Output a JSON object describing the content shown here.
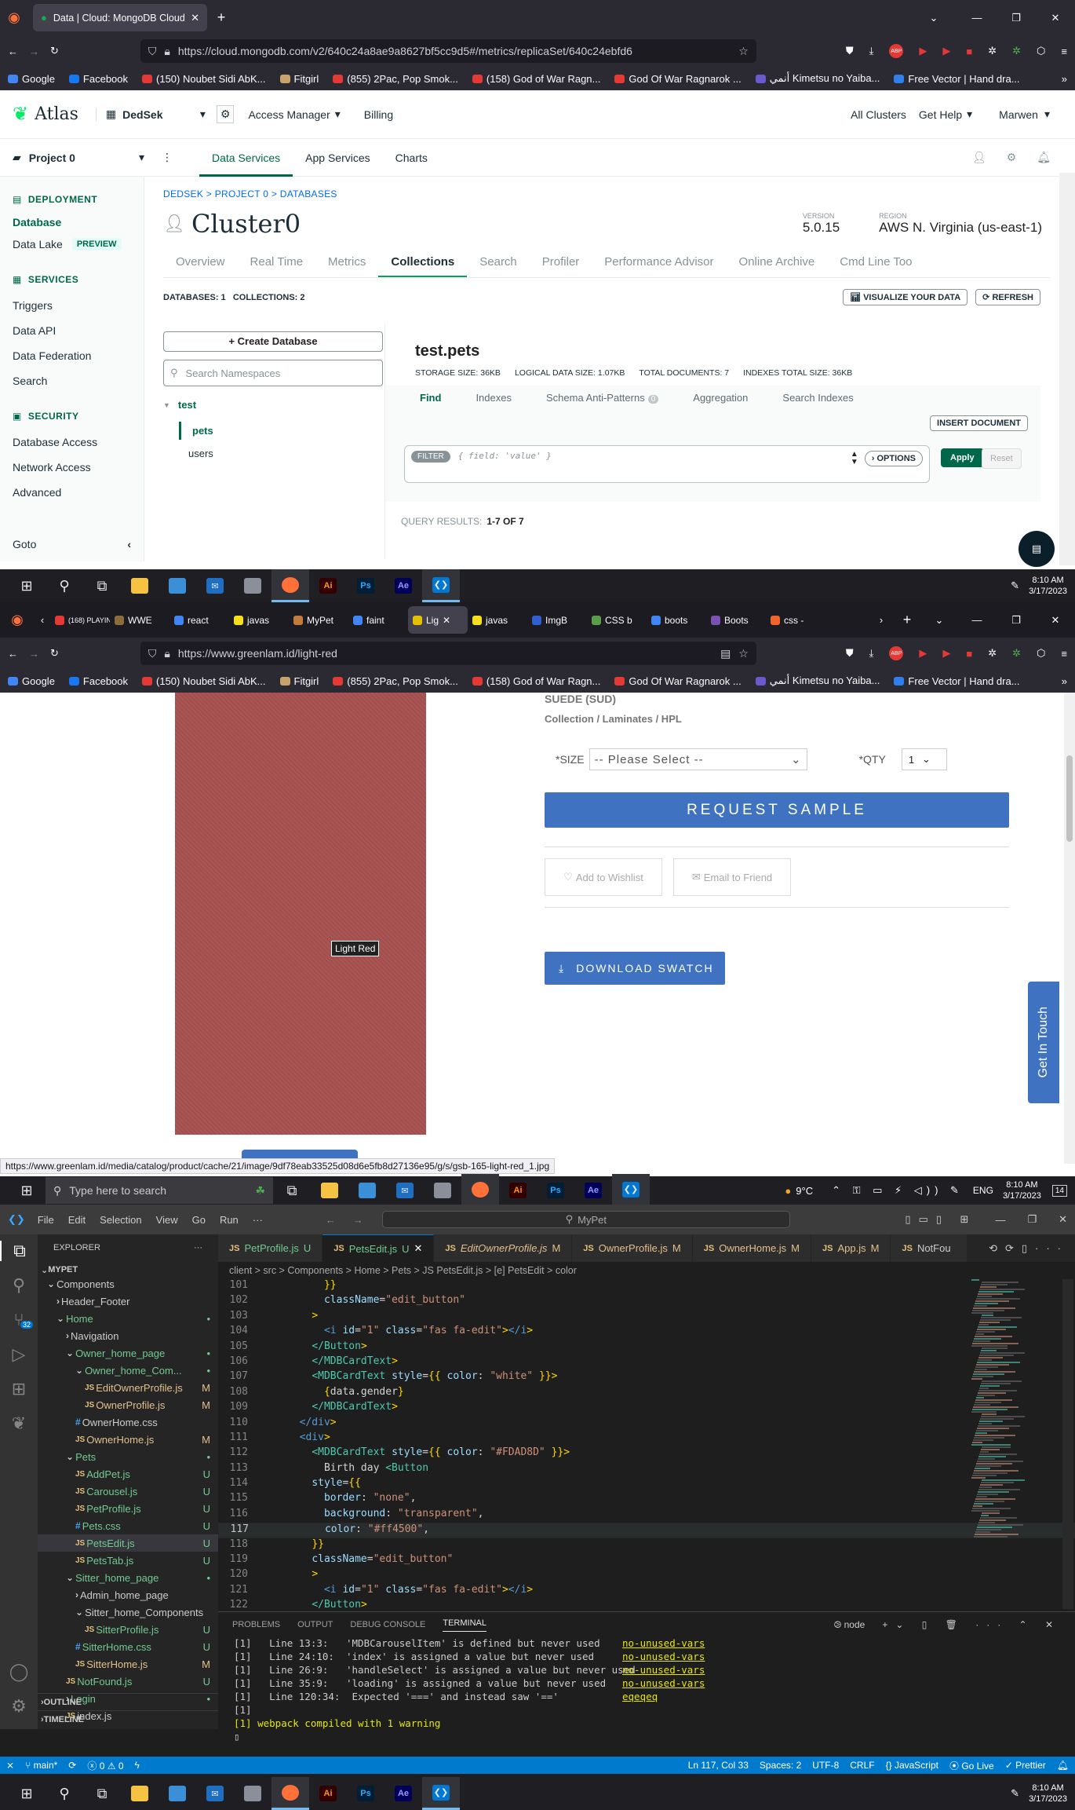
{
  "taskbar": {
    "time": "8:10 AM",
    "date": "3/17/2023",
    "search_placeholder": "Type here to search",
    "temp": "9°C",
    "lang": "ENG",
    "notif": "14"
  },
  "browser1": {
    "tab_title": "Data | Cloud: MongoDB Cloud",
    "url": "https://cloud.mongodb.com/v2/640c24a8ae9a8627bf5cc9d5#/metrics/replicaSet/640c24ebfd6",
    "bookmarks": [
      "Google",
      "Facebook",
      "(150) Noubet Sidi AbK...",
      "Fitgirl",
      "(855) 2Pac, Pop Smok...",
      "(158) God of War Ragn...",
      "God Of War Ragnarok ...",
      "أنمي Kimetsu no Yaiba...",
      "Free Vector | Hand dra..."
    ]
  },
  "atlas": {
    "logo": "Atlas",
    "org": "DedSek",
    "access_manager": "Access Manager",
    "billing": "Billing",
    "all_clusters": "All Clusters",
    "get_help": "Get Help",
    "user": "Marwen",
    "project": "Project 0",
    "nav": [
      "Data Services",
      "App Services",
      "Charts"
    ],
    "sidebar": {
      "deployment": "DEPLOYMENT",
      "database": "Database",
      "data_lake": "Data Lake",
      "preview": "PREVIEW",
      "services": "SERVICES",
      "triggers": "Triggers",
      "data_api": "Data API",
      "data_federation": "Data Federation",
      "search": "Search",
      "security": "SECURITY",
      "database_access": "Database Access",
      "network_access": "Network Access",
      "advanced": "Advanced",
      "goto": "Goto"
    },
    "breadcrumb": "DEDSEK > PROJECT 0 > DATABASES",
    "cluster": "Cluster0",
    "version_label": "VERSION",
    "version": "5.0.15",
    "region_label": "REGION",
    "region": "AWS N. Virginia (us-east-1)",
    "tabs": [
      "Overview",
      "Real Time",
      "Metrics",
      "Collections",
      "Search",
      "Profiler",
      "Performance Advisor",
      "Online Archive",
      "Cmd Line Too"
    ],
    "db_count": "DATABASES: 1   COLLECTIONS: 2",
    "visualize": "VISUALIZE YOUR DATA",
    "refresh": "REFRESH",
    "create_db": "+ Create Database",
    "search_ns": "Search Namespaces",
    "db_name": "test",
    "collections": [
      "pets",
      "users"
    ],
    "coll_title": "test.pets",
    "stats": [
      "STORAGE SIZE: 36KB",
      "LOGICAL DATA SIZE: 1.07KB",
      "TOTAL DOCUMENTS: 7",
      "INDEXES TOTAL SIZE: 36KB"
    ],
    "coll_tabs": [
      "Find",
      "Indexes",
      "Schema Anti-Patterns",
      "Aggregation",
      "Search Indexes"
    ],
    "schema_badge": "0",
    "insert_doc": "INSERT DOCUMENT",
    "filter_label": "FILTER",
    "filter_placeholder": "{ field: 'value' }",
    "options": "OPTIONS",
    "apply": "Apply",
    "reset": "Reset",
    "query_results_label": "QUERY RESULTS:",
    "query_results": "1-7 OF 7"
  },
  "browser2": {
    "tabs": [
      "(168) PLAYING",
      "WWE",
      "react",
      "javas",
      "MyPet",
      "faint",
      "Lig",
      "javas",
      "ImgB",
      "CSS b",
      "boots",
      "Boots",
      "css -"
    ],
    "url": "https://www.greenlam.id/light-red",
    "status_url": "https://www.greenlam.id/media/catalog/product/cache/21/image/9df78eab33525d08d6e5fb8d27136e95/g/s/gsb-165-light-red_1.jpg"
  },
  "greenlam": {
    "suede": "SUEDE (SUD)",
    "collection": "Collection / Laminates / HPL",
    "size_label": "*SIZE",
    "size_value": "-- Please Select --",
    "qty_label": "*QTY",
    "qty_value": "1",
    "request_sample": "REQUEST SAMPLE",
    "wishlist": "Add to Wishlist",
    "email_friend": "Email to Friend",
    "download": "DOWNLOAD SWATCH",
    "swatch_label": "Light Red",
    "get_in_touch": "Get In Touch",
    "swatch_color": "#a65150"
  },
  "vscode": {
    "menu": [
      "File",
      "Edit",
      "Selection",
      "View",
      "Go",
      "Run",
      "···"
    ],
    "search": "MyPet",
    "explorer": "EXPLORER",
    "root": "MYPET",
    "tabs": [
      {
        "name": "PetProfile.js",
        "badge": "U"
      },
      {
        "name": "PetsEdit.js",
        "badge": "U"
      },
      {
        "name": "EditOwnerProfile.js",
        "badge": "M"
      },
      {
        "name": "OwnerProfile.js",
        "badge": "M"
      },
      {
        "name": "OwnerHome.js",
        "badge": "M"
      },
      {
        "name": "App.js",
        "badge": "M"
      },
      {
        "name": "NotFou",
        "badge": ""
      }
    ],
    "breadcrumb": "client > src > Components > Home > Pets > JS PetsEdit.js > [e] PetsEdit > color",
    "tree": [
      {
        "t": "Components",
        "d": 1,
        "k": "f",
        "s": ""
      },
      {
        "t": "Header_Footer",
        "d": 2,
        "k": "fc",
        "s": ""
      },
      {
        "t": "Home",
        "d": 2,
        "k": "f",
        "s": "•"
      },
      {
        "t": "Navigation",
        "d": 3,
        "k": "fc",
        "s": ""
      },
      {
        "t": "Owner_home_page",
        "d": 3,
        "k": "f",
        "s": "•"
      },
      {
        "t": "Owner_home_Com...",
        "d": 4,
        "k": "f",
        "s": "•"
      },
      {
        "t": "EditOwnerProfile.js",
        "d": 5,
        "k": "js",
        "s": "M"
      },
      {
        "t": "OwnerProfile.js",
        "d": 5,
        "k": "js",
        "s": "M"
      },
      {
        "t": "OwnerHome.css",
        "d": 4,
        "k": "css",
        "s": ""
      },
      {
        "t": "OwnerHome.js",
        "d": 4,
        "k": "js",
        "s": "M"
      },
      {
        "t": "Pets",
        "d": 3,
        "k": "f",
        "s": "•"
      },
      {
        "t": "AddPet.js",
        "d": 4,
        "k": "js",
        "s": "U"
      },
      {
        "t": "Carousel.js",
        "d": 4,
        "k": "js",
        "s": "U"
      },
      {
        "t": "PetProfile.js",
        "d": 4,
        "k": "js",
        "s": "U"
      },
      {
        "t": "Pets.css",
        "d": 4,
        "k": "css",
        "s": "U"
      },
      {
        "t": "PetsEdit.js",
        "d": 4,
        "k": "js",
        "s": "U"
      },
      {
        "t": "PetsTab.js",
        "d": 4,
        "k": "js",
        "s": "U"
      },
      {
        "t": "Sitter_home_page",
        "d": 3,
        "k": "f",
        "s": "•"
      },
      {
        "t": "Admin_home_page",
        "d": 4,
        "k": "fc",
        "s": ""
      },
      {
        "t": "Sitter_home_Components",
        "d": 4,
        "k": "f",
        "s": ""
      },
      {
        "t": "SitterProfile.js",
        "d": 5,
        "k": "js",
        "s": "U"
      },
      {
        "t": "SitterHome.css",
        "d": 4,
        "k": "css",
        "s": "U"
      },
      {
        "t": "SitterHome.js",
        "d": 4,
        "k": "js",
        "s": "M"
      },
      {
        "t": "NotFound.js",
        "d": 3,
        "k": "js",
        "s": "U"
      },
      {
        "t": "Login",
        "d": 3,
        "k": "fc",
        "s": "•"
      },
      {
        "t": "index.js",
        "d": 3,
        "k": "js",
        "s": ""
      }
    ],
    "outline": "OUTLINE",
    "timeline": "TIMELINE",
    "code": [
      {
        "n": "101",
        "c": "      }}"
      },
      {
        "n": "102",
        "c": "      className=\"edit_button\""
      },
      {
        "n": "103",
        "c": "    >"
      },
      {
        "n": "104",
        "c": "      <i id=\"1\" class=\"fas fa-edit\"></i>"
      },
      {
        "n": "105",
        "c": "    </Button>"
      },
      {
        "n": "106",
        "c": "    </MDBCardText>"
      },
      {
        "n": "107",
        "c": "    <MDBCardText style={{ color: \"white\" }}>"
      },
      {
        "n": "108",
        "c": "      {data.gender}"
      },
      {
        "n": "109",
        "c": "    </MDBCardText>"
      },
      {
        "n": "110",
        "c": "  </div>"
      },
      {
        "n": "111",
        "c": "  <div>"
      },
      {
        "n": "112",
        "c": "    <MDBCardText style={{ color: \"#FDAD8D\" }}>"
      },
      {
        "n": "113",
        "c": "      Birth day <Button"
      },
      {
        "n": "114",
        "c": "    style={{"
      },
      {
        "n": "115",
        "c": "      border: \"none\","
      },
      {
        "n": "116",
        "c": "      background: \"transparent\","
      },
      {
        "n": "117",
        "c": "      color: \"#ff4500\","
      },
      {
        "n": "118",
        "c": "    }}"
      },
      {
        "n": "119",
        "c": "    className=\"edit_button\""
      },
      {
        "n": "120",
        "c": "    >"
      },
      {
        "n": "121",
        "c": "      <i id=\"1\" class=\"fas fa-edit\"></i>"
      },
      {
        "n": "122",
        "c": "    </Button>"
      },
      {
        "n": "123",
        "c": "    </MDBCardText>"
      }
    ],
    "panel_tabs": [
      "PROBLEMS",
      "OUTPUT",
      "DEBUG CONSOLE",
      "TERMINAL"
    ],
    "term_name": "node",
    "terminal": [
      {
        "t": "[1]   Line 13:3:   'MDBCarouselItem' is defined but never used",
        "r": "no-unused-vars"
      },
      {
        "t": "[1]   Line 24:10:  'index' is assigned a value but never used",
        "r": "no-unused-vars"
      },
      {
        "t": "[1]   Line 26:9:   'handleSelect' is assigned a value but never used",
        "r": "no-unused-vars"
      },
      {
        "t": "[1]   Line 35:9:   'loading' is assigned a value but never used",
        "r": "no-unused-vars"
      },
      {
        "t": "[1]   Line 120:34:  Expected '===' and instead saw '=='",
        "r": "eqeqeq"
      },
      {
        "t": "[1]",
        "r": ""
      },
      {
        "t": "[1] webpack compiled with 1 warning",
        "r": ""
      }
    ],
    "status": {
      "branch": "main*",
      "errors": "0",
      "warnings": "0",
      "pos": "Ln 117, Col 33",
      "spaces": "Spaces: 2",
      "enc": "UTF-8",
      "eol": "CRLF",
      "lang": "{} JavaScript",
      "golive": "Go Live",
      "prettier": "✓ Prettier"
    }
  }
}
